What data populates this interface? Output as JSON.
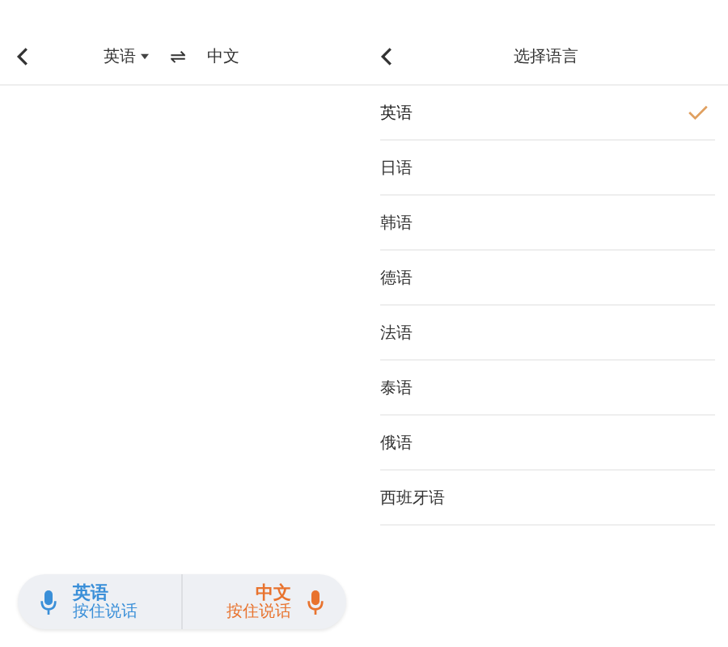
{
  "translator": {
    "source_language": "英语",
    "swap": "⇌",
    "target_language": "中文",
    "talk_buttons": [
      {
        "language": "英语",
        "hint": "按住说话",
        "color": "#3a8fd8"
      },
      {
        "language": "中文",
        "hint": "按住说话",
        "color": "#e8732e"
      }
    ]
  },
  "language_picker": {
    "title": "选择语言",
    "languages": [
      {
        "label": "英语",
        "selected": true
      },
      {
        "label": "日语",
        "selected": false
      },
      {
        "label": "韩语",
        "selected": false
      },
      {
        "label": "德语",
        "selected": false
      },
      {
        "label": "法语",
        "selected": false
      },
      {
        "label": "泰语",
        "selected": false
      },
      {
        "label": "俄语",
        "selected": false
      },
      {
        "label": "西班牙语",
        "selected": false
      }
    ]
  }
}
